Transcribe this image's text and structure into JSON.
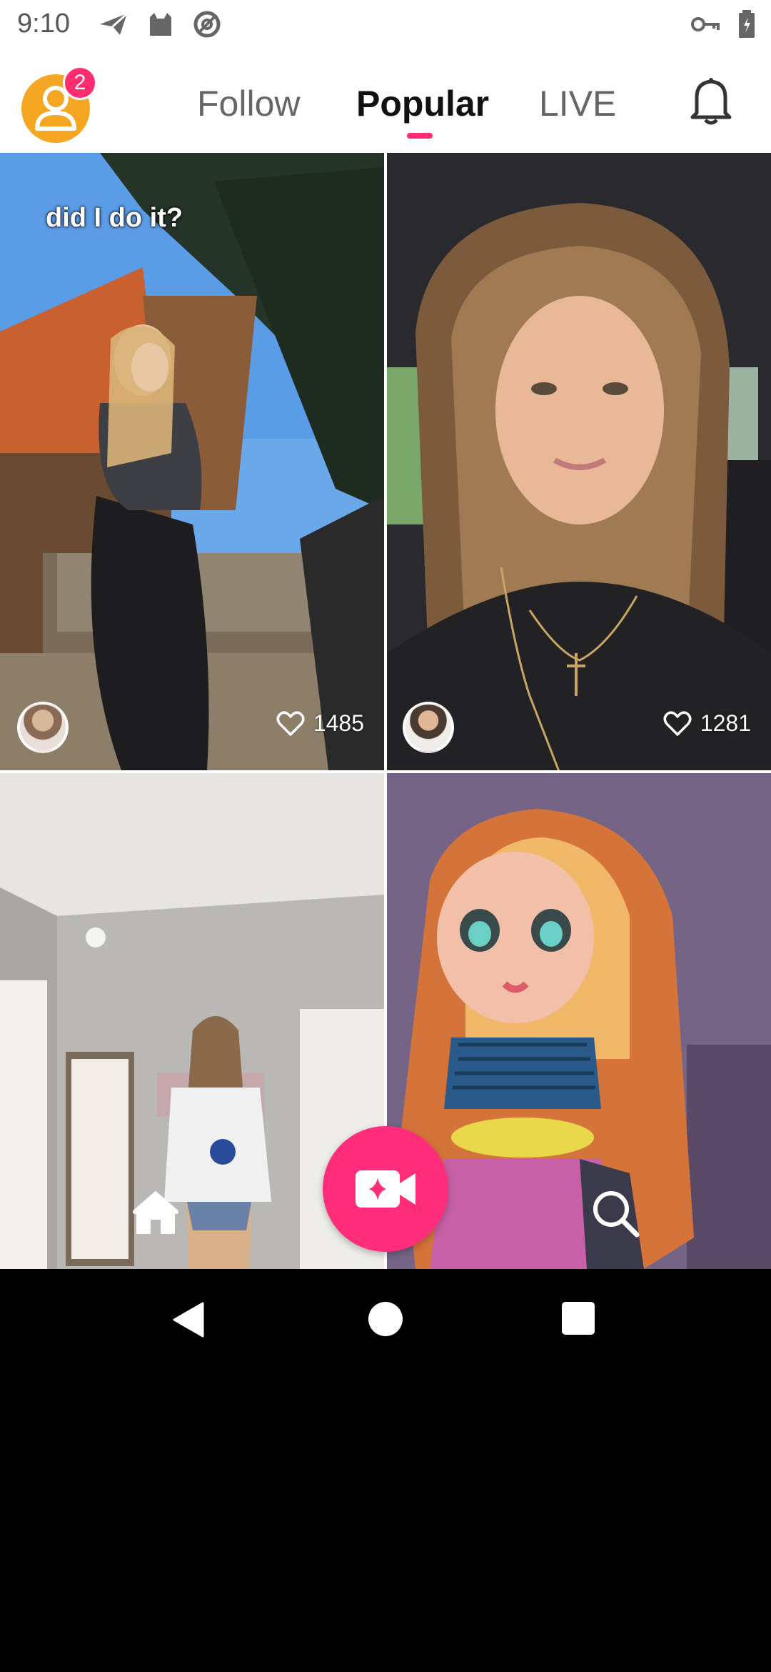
{
  "status_bar": {
    "time": "9:10",
    "left_icons": [
      "send-icon",
      "cat-icon",
      "at-sign-icon"
    ],
    "right_icons": [
      "key-icon",
      "battery-icon"
    ]
  },
  "header": {
    "notification_badge": "2",
    "tabs": [
      {
        "label": "Follow",
        "active": false
      },
      {
        "label": "Popular",
        "active": true
      },
      {
        "label": "LIVE",
        "active": false
      }
    ],
    "accent_color": "#ff2d6f"
  },
  "feed": {
    "cards": [
      {
        "caption": "did I do it?",
        "likes": "1485"
      },
      {
        "caption": "",
        "likes": "1281"
      },
      {
        "caption": "",
        "likes": ""
      },
      {
        "caption": "",
        "likes": ""
      }
    ]
  },
  "bottom_nav": {
    "icons": [
      "home-icon",
      "video-camera-sparkle-icon",
      "search-icon"
    ],
    "record_color": "#ff2d7a"
  },
  "system_nav": {
    "icons": [
      "back-icon",
      "home-circle-icon",
      "recents-icon"
    ]
  }
}
